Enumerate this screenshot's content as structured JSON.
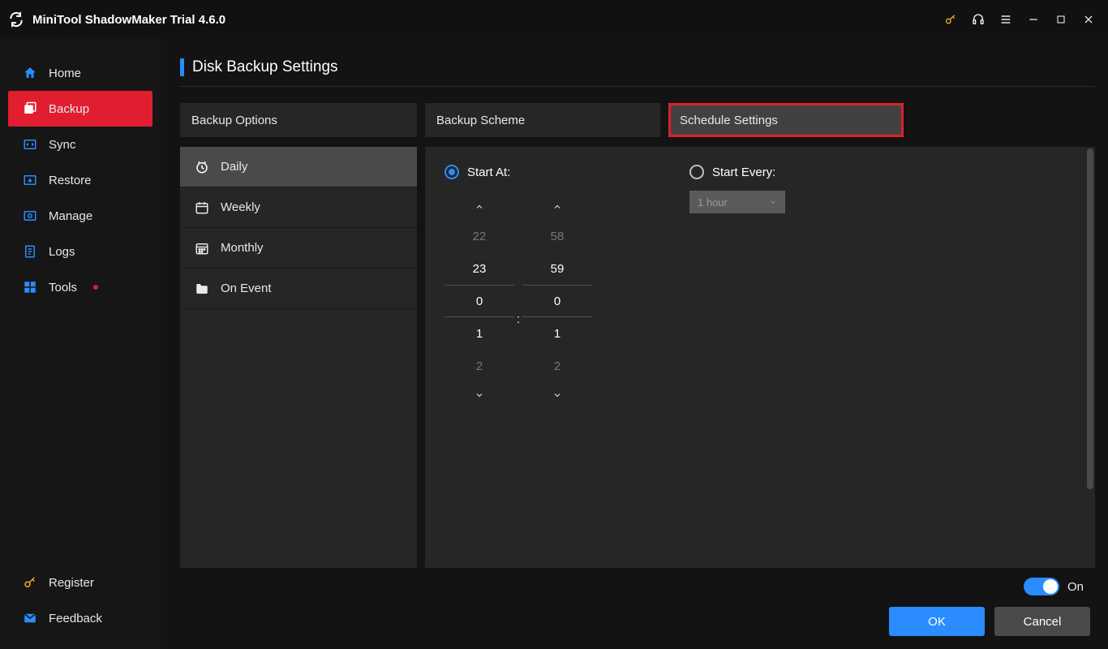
{
  "app": {
    "title": "MiniTool ShadowMaker Trial 4.6.0"
  },
  "colors": {
    "accent": "#2a8cff",
    "danger": "#e11d30"
  },
  "sidebar": {
    "items": [
      {
        "label": "Home"
      },
      {
        "label": "Backup"
      },
      {
        "label": "Sync"
      },
      {
        "label": "Restore"
      },
      {
        "label": "Manage"
      },
      {
        "label": "Logs"
      },
      {
        "label": "Tools"
      }
    ],
    "active_index": 1,
    "bottom": [
      {
        "label": "Register"
      },
      {
        "label": "Feedback"
      }
    ]
  },
  "page": {
    "title": "Disk Backup Settings"
  },
  "tabs": [
    {
      "label": "Backup Options"
    },
    {
      "label": "Backup Scheme"
    },
    {
      "label": "Schedule Settings"
    }
  ],
  "tabs_active_index": 2,
  "schedule_modes": [
    {
      "label": "Daily"
    },
    {
      "label": "Weekly"
    },
    {
      "label": "Monthly"
    },
    {
      "label": "On Event"
    }
  ],
  "schedule_modes_active_index": 0,
  "schedule_panel": {
    "start_at_label": "Start At:",
    "start_every_label": "Start Every:",
    "start_at_selected": true,
    "every_value": "1 hour",
    "time_picker": {
      "hours": {
        "vals": [
          "22",
          "23",
          "0",
          "1",
          "2"
        ],
        "selected_index": 2
      },
      "minutes": {
        "vals": [
          "58",
          "59",
          "0",
          "1",
          "2"
        ],
        "selected_index": 2
      },
      "separator": ":"
    }
  },
  "footer": {
    "toggle_label": "On",
    "toggle_on": true,
    "ok_label": "OK",
    "cancel_label": "Cancel"
  }
}
